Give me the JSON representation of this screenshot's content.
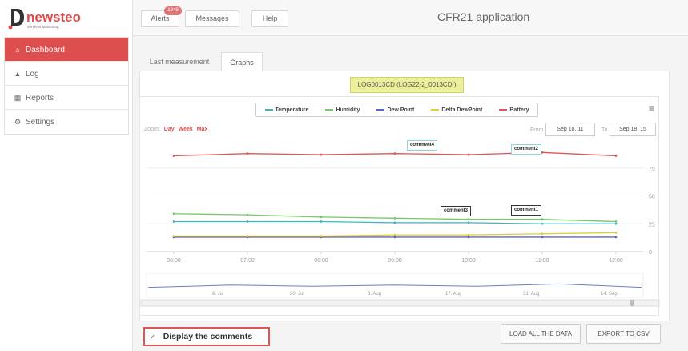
{
  "brand": {
    "name": "newsteo",
    "tagline": "Wireless Monitoring"
  },
  "sidebar": {
    "items": [
      {
        "label": "Dashboard",
        "icon": "home-icon"
      },
      {
        "label": "Log",
        "icon": "bell-icon"
      },
      {
        "label": "Reports",
        "icon": "report-icon"
      },
      {
        "label": "Settings",
        "icon": "settings-icon"
      }
    ]
  },
  "topbar": {
    "alerts_label": "Alerts",
    "alerts_badge": "1949",
    "messages_label": "Messages",
    "help_label": "Help",
    "app_title": "CFR21 application"
  },
  "tabs": [
    "Last measurement",
    "Graphs"
  ],
  "sensor_label": "LOG0013CD (LOG22-2_0013CD )",
  "chart": {
    "zoom_label": "Zoom:",
    "zoom_options": [
      "Day",
      "Week",
      "Max"
    ],
    "from_label": "From",
    "from_value": "Sep 18, 11",
    "to_label": "To",
    "to_value": "Sep 18, 15",
    "menu_icon": "hamburger-menu-icon",
    "navigator_labels": [
      "6. Jul",
      "20. Jul",
      "3. Aug",
      "17. Aug",
      "31. Aug",
      "14. Sep"
    ]
  },
  "comments": [
    "comment4",
    "comment2",
    "comment3",
    "comment1"
  ],
  "chart_data": {
    "type": "line",
    "x": [
      "06:00",
      "07:00",
      "08:00",
      "09:00",
      "10:00",
      "11:00",
      "12:00"
    ],
    "ylim": [
      0,
      100
    ],
    "yticks": [
      0,
      25,
      50,
      75
    ],
    "legend_position": "top",
    "series": [
      {
        "name": "Temperature",
        "color": "#43b2c9",
        "values": [
          27,
          27,
          27,
          26,
          26,
          25,
          25
        ]
      },
      {
        "name": "Humidity",
        "color": "#72cc63",
        "values": [
          34,
          33,
          31,
          30,
          29,
          29,
          27
        ]
      },
      {
        "name": "Dew Point",
        "color": "#5a66c4",
        "values": [
          13,
          13,
          13,
          13,
          13,
          13,
          13
        ]
      },
      {
        "name": "Delta DewPoint",
        "color": "#e0cc3a",
        "values": [
          14,
          14,
          14,
          15,
          15,
          16,
          17
        ]
      },
      {
        "name": "Battery",
        "color": "#e05555",
        "values": [
          86,
          88,
          87,
          88,
          87,
          89,
          86
        ]
      }
    ]
  },
  "footer": {
    "display_comments_label": "Display the comments",
    "load_all_label": "LOAD ALL THE DATA",
    "export_label": "EXPORT TO CSV"
  }
}
